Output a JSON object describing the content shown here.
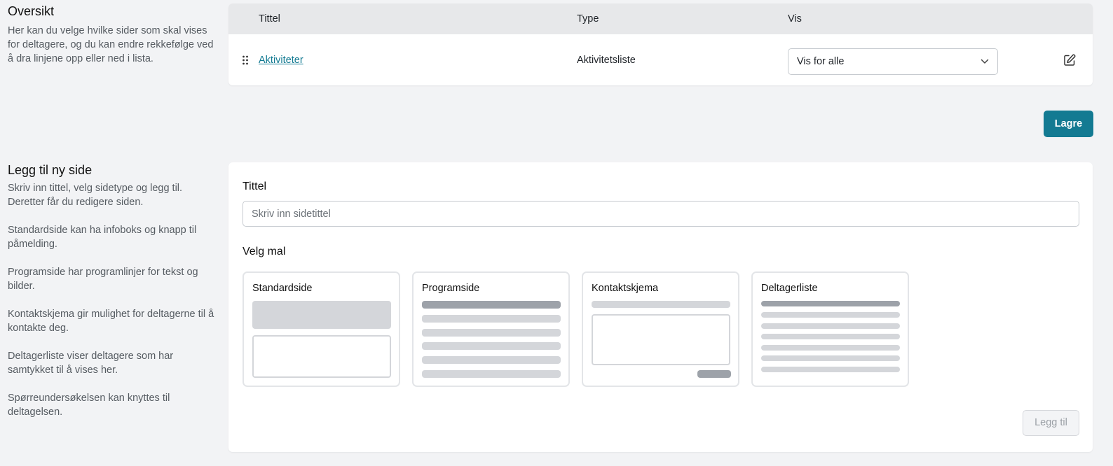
{
  "overview": {
    "title": "Oversikt",
    "description": "Her kan du velge hvilke sider som skal vises for deltagere, og du kan endre rekkefølge ved å dra linjene opp eller ned i lista.",
    "columns": {
      "title": "Tittel",
      "type": "Type",
      "show": "Vis"
    },
    "rows": [
      {
        "title": "Aktiviteter",
        "type": "Aktivitetsliste",
        "show": "Vis for alle"
      }
    ],
    "save_label": "Lagre"
  },
  "add_page": {
    "title": "Legg til ny side",
    "descriptions": [
      "Skriv inn tittel, velg sidetype og legg til. Deretter får du redigere siden.",
      "Standardside kan ha infoboks og knapp til påmelding.",
      "Programside har programlinjer for tekst og bilder.",
      "Kontaktskjema gir mulighet for deltagerne til å kontakte deg.",
      "Deltagerliste viser deltagere som har samtykket til å vises her.",
      "Spørreundersøkelsen kan knyttes til deltagelsen."
    ],
    "title_label": "Tittel",
    "title_placeholder": "Skriv inn sidetittel",
    "template_label": "Velg mal",
    "templates": [
      {
        "name": "Standardside"
      },
      {
        "name": "Programside"
      },
      {
        "name": "Kontaktskjema"
      },
      {
        "name": "Deltagerliste"
      }
    ],
    "add_label": "Legg til"
  },
  "colors": {
    "accent": "#137a92",
    "background": "#f2f3f5",
    "header_bg": "#e7e8ea"
  },
  "icons": [
    "drag-handle-icon",
    "chevron-down-icon",
    "edit-icon"
  ]
}
